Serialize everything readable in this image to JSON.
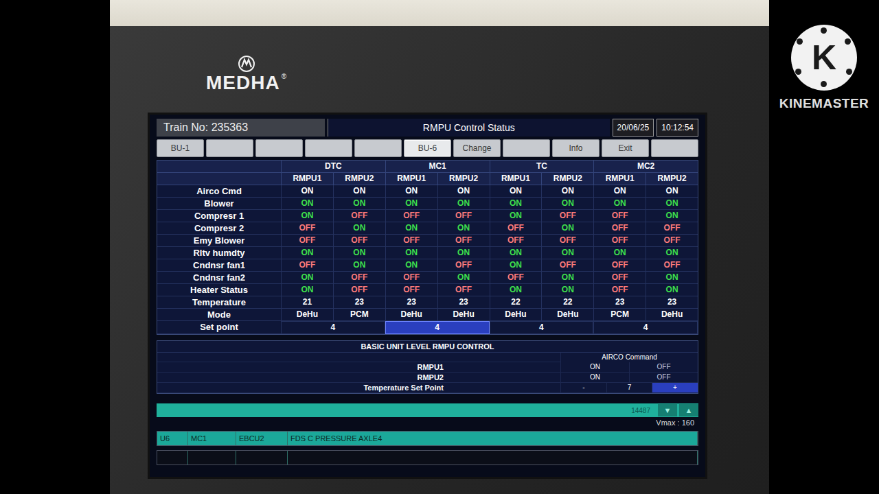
{
  "watermark": {
    "icon_letter": "K",
    "label": "KINEMASTER"
  },
  "bezel": {
    "brand": "MEDHA",
    "registered": "®"
  },
  "header": {
    "train": "Train No: 235363",
    "title": "RMPU Control Status",
    "date": "20/06/25",
    "time": "10:12:54"
  },
  "tabs": [
    {
      "label": "BU-1",
      "selected": false
    },
    {
      "label": "",
      "selected": false
    },
    {
      "label": "",
      "selected": false
    },
    {
      "label": "",
      "selected": false
    },
    {
      "label": "",
      "selected": false
    },
    {
      "label": "BU-6",
      "selected": true
    },
    {
      "label": "Change",
      "selected": false
    },
    {
      "label": "",
      "selected": false
    },
    {
      "label": "Info",
      "selected": false
    },
    {
      "label": "Exit",
      "selected": false
    },
    {
      "label": "",
      "selected": false
    }
  ],
  "table": {
    "groups": [
      {
        "name": "DTC",
        "units": [
          "RMPU1",
          "RMPU2"
        ],
        "set_point": "4",
        "selected": false
      },
      {
        "name": "MC1",
        "units": [
          "RMPU1",
          "RMPU2"
        ],
        "set_point": "4",
        "selected": true
      },
      {
        "name": "TC",
        "units": [
          "RMPU1",
          "RMPU2"
        ],
        "set_point": "4",
        "selected": false
      },
      {
        "name": "MC2",
        "units": [
          "RMPU1",
          "RMPU2"
        ],
        "set_point": "4",
        "selected": false
      }
    ],
    "set_point_label": "Set point",
    "rows": [
      {
        "label": "Airco Cmd",
        "kind": "command",
        "cells": [
          {
            "text": "ON"
          },
          {
            "text": "ON"
          },
          {
            "text": "ON"
          },
          {
            "text": "ON"
          },
          {
            "text": "ON"
          },
          {
            "text": "ON"
          },
          {
            "text": "ON"
          },
          {
            "text": "ON"
          }
        ]
      },
      {
        "label": "Blower",
        "kind": "status",
        "cells": [
          {
            "text": "ON",
            "on": true
          },
          {
            "text": "ON",
            "on": true
          },
          {
            "text": "ON",
            "on": true
          },
          {
            "text": "ON",
            "on": true
          },
          {
            "text": "ON",
            "on": true
          },
          {
            "text": "ON",
            "on": true
          },
          {
            "text": "ON",
            "on": true
          },
          {
            "text": "ON",
            "on": true
          }
        ]
      },
      {
        "label": "Compresr 1",
        "kind": "status",
        "cells": [
          {
            "text": "ON",
            "on": true
          },
          {
            "text": "OFF",
            "on": false
          },
          {
            "text": "OFF",
            "on": false
          },
          {
            "text": "OFF",
            "on": false
          },
          {
            "text": "ON",
            "on": true
          },
          {
            "text": "OFF",
            "on": false
          },
          {
            "text": "OFF",
            "on": false
          },
          {
            "text": "ON",
            "on": true
          }
        ]
      },
      {
        "label": "Compresr 2",
        "kind": "status",
        "cells": [
          {
            "text": "OFF",
            "on": false
          },
          {
            "text": "ON",
            "on": true
          },
          {
            "text": "ON",
            "on": true
          },
          {
            "text": "ON",
            "on": true
          },
          {
            "text": "OFF",
            "on": false
          },
          {
            "text": "ON",
            "on": true
          },
          {
            "text": "OFF",
            "on": false
          },
          {
            "text": "OFF",
            "on": false
          }
        ]
      },
      {
        "label": "Emy Blower",
        "kind": "status",
        "cells": [
          {
            "text": "OFF",
            "on": false
          },
          {
            "text": "OFF",
            "on": false
          },
          {
            "text": "OFF",
            "on": false
          },
          {
            "text": "OFF",
            "on": false
          },
          {
            "text": "OFF",
            "on": false
          },
          {
            "text": "OFF",
            "on": false
          },
          {
            "text": "OFF",
            "on": false
          },
          {
            "text": "OFF",
            "on": false
          }
        ]
      },
      {
        "label": "Rltv humdty",
        "kind": "status",
        "cells": [
          {
            "text": "ON",
            "on": true
          },
          {
            "text": "ON",
            "on": true
          },
          {
            "text": "ON",
            "on": true
          },
          {
            "text": "ON",
            "on": true
          },
          {
            "text": "ON",
            "on": true
          },
          {
            "text": "ON",
            "on": true
          },
          {
            "text": "ON",
            "on": true
          },
          {
            "text": "ON",
            "on": true
          }
        ]
      },
      {
        "label": "Cndnsr fan1",
        "kind": "status",
        "cells": [
          {
            "text": "OFF",
            "on": false
          },
          {
            "text": "ON",
            "on": true
          },
          {
            "text": "ON",
            "on": true
          },
          {
            "text": "OFF",
            "on": false
          },
          {
            "text": "ON",
            "on": true
          },
          {
            "text": "OFF",
            "on": false
          },
          {
            "text": "OFF",
            "on": false
          },
          {
            "text": "OFF",
            "on": false
          }
        ]
      },
      {
        "label": "Cndnsr fan2",
        "kind": "status",
        "cells": [
          {
            "text": "ON",
            "on": true
          },
          {
            "text": "OFF",
            "on": false
          },
          {
            "text": "OFF",
            "on": false
          },
          {
            "text": "ON",
            "on": true
          },
          {
            "text": "OFF",
            "on": false
          },
          {
            "text": "ON",
            "on": true
          },
          {
            "text": "OFF",
            "on": false
          },
          {
            "text": "ON",
            "on": true
          }
        ]
      },
      {
        "label": "Heater Status",
        "kind": "status",
        "cells": [
          {
            "text": "ON",
            "on": true
          },
          {
            "text": "OFF",
            "on": false
          },
          {
            "text": "OFF",
            "on": false
          },
          {
            "text": "OFF",
            "on": false
          },
          {
            "text": "ON",
            "on": true
          },
          {
            "text": "ON",
            "on": true
          },
          {
            "text": "OFF",
            "on": false
          },
          {
            "text": "ON",
            "on": true
          }
        ]
      },
      {
        "label": "Temperature",
        "kind": "value",
        "cells": [
          {
            "text": "21"
          },
          {
            "text": "23"
          },
          {
            "text": "23"
          },
          {
            "text": "23"
          },
          {
            "text": "22"
          },
          {
            "text": "22"
          },
          {
            "text": "23"
          },
          {
            "text": "23"
          }
        ]
      },
      {
        "label": "Mode",
        "kind": "value",
        "cells": [
          {
            "text": "DeHu"
          },
          {
            "text": "PCM"
          },
          {
            "text": "DeHu"
          },
          {
            "text": "DeHu"
          },
          {
            "text": "DeHu"
          },
          {
            "text": "DeHu"
          },
          {
            "text": "PCM"
          },
          {
            "text": "DeHu"
          }
        ]
      }
    ]
  },
  "basic_unit": {
    "title": "BASIC UNIT LEVEL RMPU CONTROL",
    "command_header": "AIRCO Command",
    "units": [
      {
        "name": "RMPU1",
        "on_label": "ON",
        "off_label": "OFF",
        "on": true
      },
      {
        "name": "RMPU2",
        "on_label": "ON",
        "off_label": "OFF",
        "on": true
      }
    ],
    "set_point": {
      "label": "Temperature Set Point",
      "value": "7",
      "buttons": [
        {
          "label": "-",
          "selected": false
        },
        {
          "label": "+",
          "selected": true
        }
      ]
    }
  },
  "status_bar": {
    "counter": "14487",
    "down": "▼",
    "up": "▲",
    "vmax": "Vmax : 160"
  },
  "alarms": [
    {
      "cells": [
        "U6",
        "MC1",
        "EBCU2",
        "FDS C PRESSURE AXLE4"
      ],
      "active": true
    },
    {
      "cells": [
        "",
        "",
        "",
        ""
      ],
      "active": false
    }
  ]
}
